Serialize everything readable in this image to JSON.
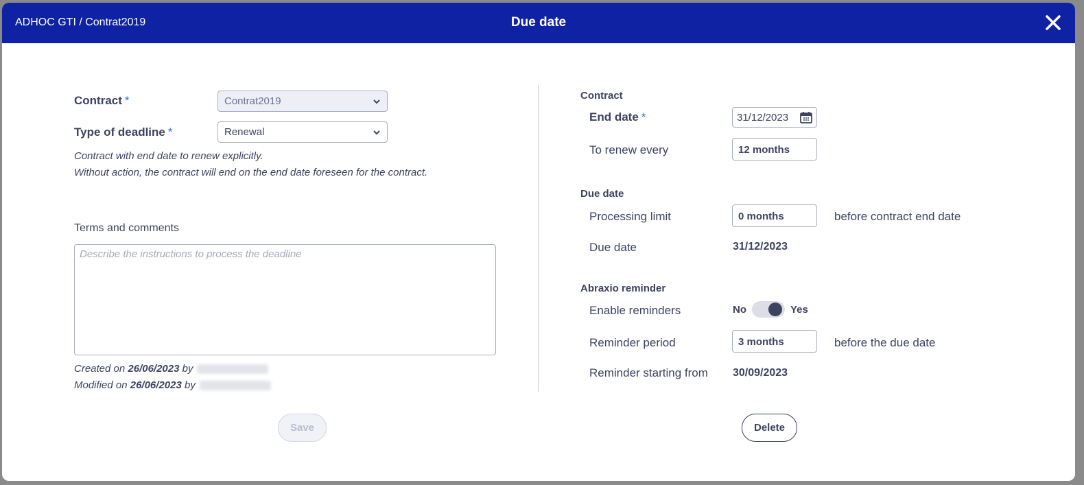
{
  "header": {
    "breadcrumb": "ADHOC GTI / Contrat2019",
    "title": "Due date"
  },
  "left": {
    "contract_label": "Contract",
    "contract_value": "Contrat2019",
    "deadline_type_label": "Type of deadline",
    "deadline_type_value": "Renewal",
    "required_marker": "*",
    "hint_line1": "Contract with end date to renew explicitly.",
    "hint_line2": "Without action, the contract will end on the end date foreseen for the contract.",
    "terms_label": "Terms and comments",
    "terms_placeholder": "Describe the instructions to process the deadline",
    "created_prefix": "Created on",
    "created_date": "26/06/2023",
    "modified_prefix": "Modified on",
    "modified_date": "26/06/2023",
    "by": "by",
    "save_label": "Save"
  },
  "right": {
    "contract_section": "Contract",
    "end_date_label": "End date",
    "end_date_value": "31/12/2023",
    "renew_label": "To renew every",
    "renew_value": "12 months",
    "due_section": "Due date",
    "processing_label": "Processing limit",
    "processing_value": "0 months",
    "processing_suffix": "before contract end date",
    "due_label": "Due date",
    "due_value": "31/12/2023",
    "reminder_section": "Abraxio reminder",
    "enable_label": "Enable reminders",
    "toggle_no": "No",
    "toggle_yes": "Yes",
    "reminder_period_label": "Reminder period",
    "reminder_period_value": "3 months",
    "reminder_period_suffix": "before the due date",
    "reminder_start_label": "Reminder starting from",
    "reminder_start_value": "30/09/2023",
    "delete_label": "Delete"
  },
  "colors": {
    "header_bg": "#0f22a3",
    "text": "#3c4260",
    "accent": "#2b6ef2"
  }
}
